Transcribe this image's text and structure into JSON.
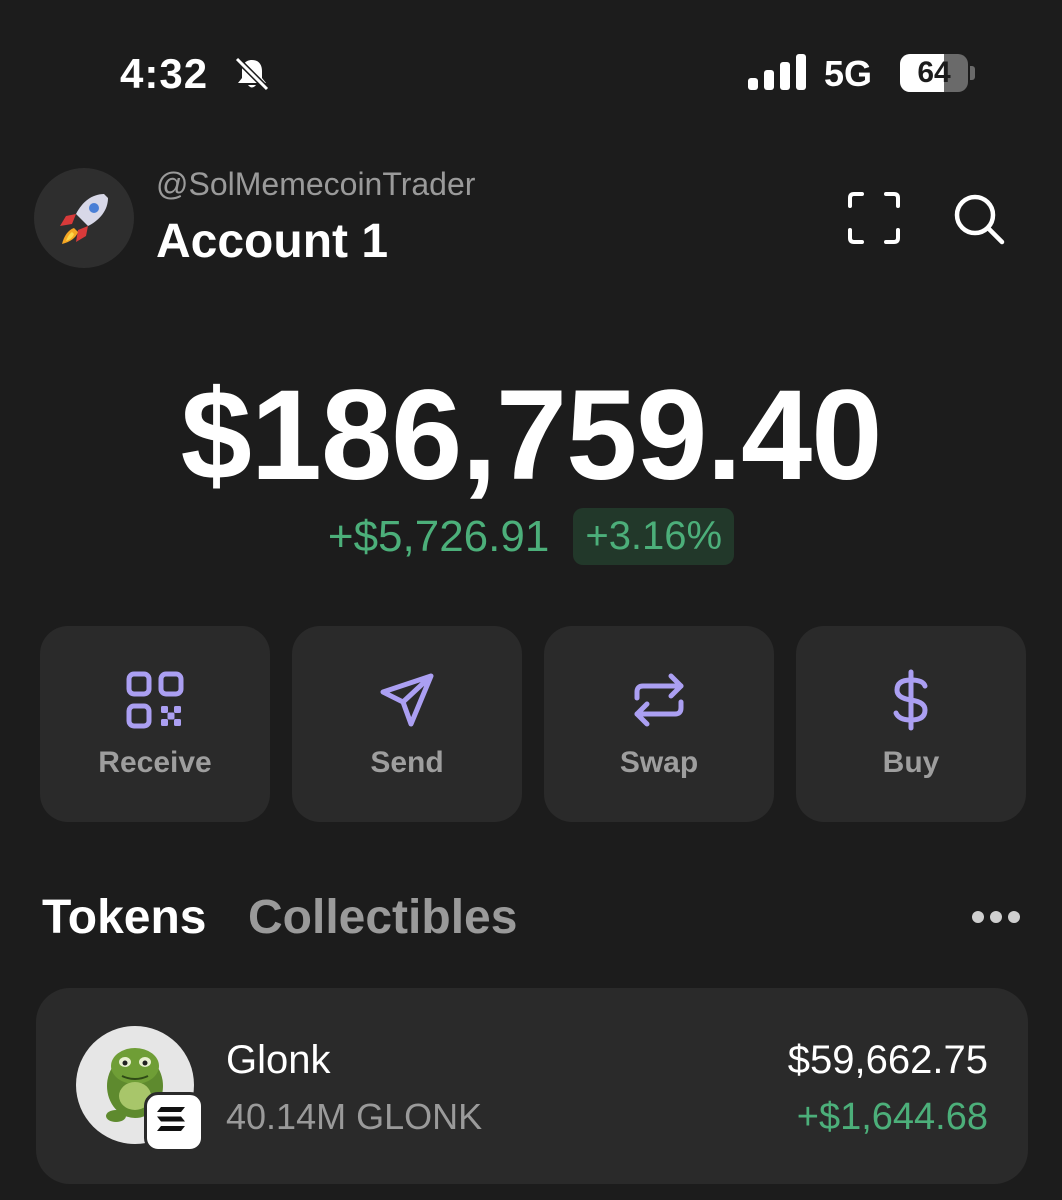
{
  "status_bar": {
    "time": "4:32",
    "network": "5G",
    "battery_level": "64",
    "battery_fraction": 0.64,
    "icons": [
      "bell-slash-icon",
      "signal-bars-icon",
      "battery-icon"
    ]
  },
  "header": {
    "handle": "@SolMemecoinTrader",
    "account_name": "Account 1",
    "avatar_icon": "rocket-icon",
    "right_icons": [
      "scan-frame-icon",
      "search-icon"
    ]
  },
  "balance": {
    "total": "$186,759.40",
    "change_amount": "+$5,726.91",
    "change_percent": "+3.16%"
  },
  "actions": [
    {
      "label": "Receive",
      "icon": "qr-code-icon"
    },
    {
      "label": "Send",
      "icon": "paper-plane-icon"
    },
    {
      "label": "Swap",
      "icon": "swap-arrows-icon"
    },
    {
      "label": "Buy",
      "icon": "dollar-icon"
    }
  ],
  "tabs": {
    "tokens": "Tokens",
    "collectibles": "Collectibles",
    "more_icon": "ellipsis-icon"
  },
  "tokens": [
    {
      "name": "Glonk",
      "quantity": "40.14M GLONK",
      "value": "$59,662.75",
      "change": "+$1,644.68",
      "logo_text": "Glonk",
      "chain_icon": "solana-icon"
    }
  ],
  "colors": {
    "background": "#1c1c1c",
    "card": "#2a2a2a",
    "accent_purple": "#ab9ff2",
    "positive_green": "#4caf7a"
  }
}
